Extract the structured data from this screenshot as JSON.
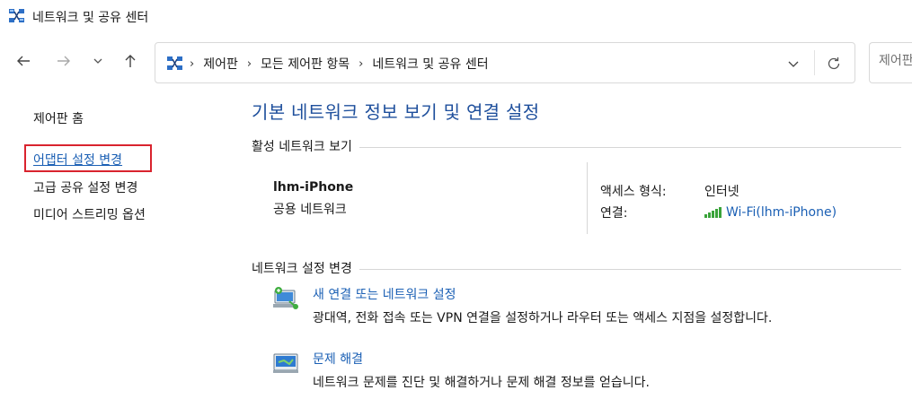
{
  "window": {
    "title": "네트워크 및 공유 센터",
    "icon": "network-center-icon"
  },
  "nav": {
    "back_icon": "arrow-left-icon",
    "forward_icon": "arrow-right-icon",
    "recent_icon": "chevron-down-icon",
    "up_icon": "arrow-up-icon"
  },
  "address": {
    "breadcrumbs": [
      "제어판",
      "모든 제어판 항목",
      "네트워크 및 공유 센터"
    ],
    "separator": "›",
    "dropdown_icon": "chevron-down-icon",
    "refresh_icon": "refresh-icon"
  },
  "search": {
    "placeholder": "제어판"
  },
  "sidebar": {
    "home": "제어판 홈",
    "items": [
      {
        "label": "어댑터 설정 변경",
        "active": true
      },
      {
        "label": "고급 공유 설정 변경",
        "active": false
      },
      {
        "label": "미디어 스트리밍 옵션",
        "active": false
      }
    ],
    "highlight_color": "#d9232e"
  },
  "main": {
    "title": "기본 네트워크 정보 보기 및 연결 설정",
    "active_section": {
      "heading": "활성 네트워크 보기",
      "network_name": "lhm-iPhone",
      "network_type": "공용 네트워크",
      "access_label": "액세스 형식:",
      "access_value": "인터넷",
      "connection_label": "연결:",
      "connection_value": "Wi-Fi(lhm-iPhone)",
      "connection_icon": "wifi-signal-icon"
    },
    "change_section": {
      "heading": "네트워크 설정 변경",
      "tasks": [
        {
          "title": "새 연결 또는 네트워크 설정",
          "description": "광대역, 전화 접속 또는 VPN 연결을 설정하거나 라우터 또는 액세스 지점을 설정합니다.",
          "icon": "new-connection-icon"
        },
        {
          "title": "문제 해결",
          "description": "네트워크 문제를 진단 및 해결하거나 문제 해결 정보를 얻습니다.",
          "icon": "troubleshoot-icon"
        }
      ]
    }
  },
  "colors": {
    "link": "#1a5fb4",
    "title": "#1e4f9c",
    "signal": "#3aa33a"
  }
}
